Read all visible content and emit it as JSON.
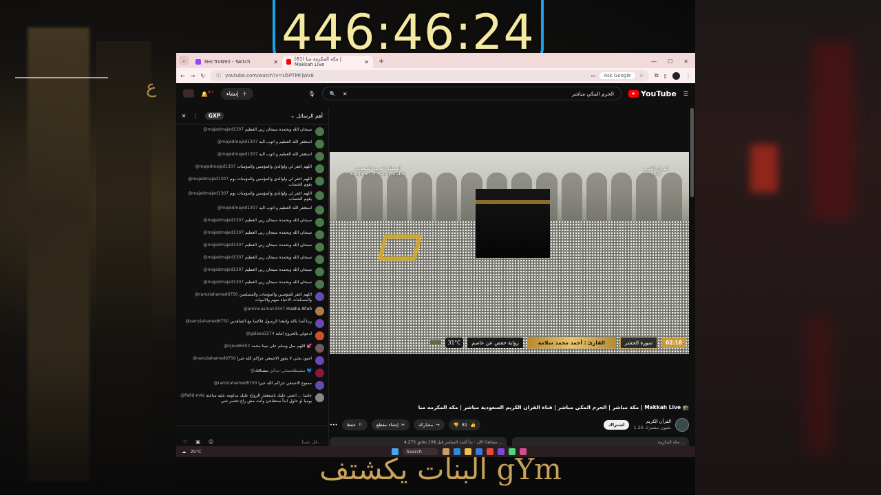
{
  "overlay": {
    "timer": "446:46:24",
    "caption": "البنات يكشتف gYm"
  },
  "browser": {
    "tabs": [
      {
        "label": "NecTroN90 - Twitch",
        "color": "#9146ff"
      },
      {
        "label": "(61) مكة المكرمة مبا | Makkah Live",
        "color": "#ff0000"
      }
    ],
    "url": "youtube.com/watch?v=U5PTMFjWx8",
    "ask_google": "Ask Google"
  },
  "youtube": {
    "logo": "YouTube",
    "search_query": "الحرم المكي مباشر",
    "create_label": "إنشاء",
    "notif_count": "9+"
  },
  "chat": {
    "title": "أهم الرسائل",
    "gxp": "GXP",
    "input_placeholder": "قل شيئا...",
    "messages": [
      {
        "author": "@majedmajed1307",
        "text": "سبحان الله وبحمده سبحان ربي العظيم",
        "av": "#4a7a4a"
      },
      {
        "author": "@majedmajed1307",
        "text": "استغفر الله العظيم و اتوب اليه",
        "av": "#4a7a4a"
      },
      {
        "author": "@majedmajed1307",
        "text": "استغفر الله العظيم و اتوب اليه",
        "av": "#4a7a4a"
      },
      {
        "author": "@majedmajed1307",
        "text": "اللهم اغفر لي ولوالدي والمؤمنين والمؤمنات",
        "av": "#4a7a4a"
      },
      {
        "author": "@majedmajed1307",
        "text": "اللهم اغفر لي ولوالدي والمؤمنين والمؤمنات يوم يقوم الحساب",
        "av": "#4a7a4a"
      },
      {
        "author": "@majedmajed1307",
        "text": "اللهم اغفر لي ولوالدي والمؤمنين والمؤمنات يوم يقوم الحساب",
        "av": "#4a7a4a"
      },
      {
        "author": "@majedmajed1307",
        "text": "استغفر الله العظيم و اتوب اليه",
        "av": "#4a7a4a"
      },
      {
        "author": "@majedmajed1307",
        "text": "سبحان الله وبحمده سبحان ربي العظيم",
        "av": "#4a7a4a"
      },
      {
        "author": "@majedmajed1307",
        "text": "سبحان الله وبحمده سبحان ربي العظيم",
        "av": "#4a7a4a"
      },
      {
        "author": "@majedmajed1307",
        "text": "سبحان الله وبحمده سبحان ربي العظيم",
        "av": "#4a7a4a"
      },
      {
        "author": "@majedmajed1307",
        "text": "سبحان الله وبحمده سبحان ربي العظيم",
        "av": "#4a7a4a"
      },
      {
        "author": "@majedmajed1307",
        "text": "سبحان الله وبحمده سبحان ربي العظيم",
        "av": "#4a7a4a"
      },
      {
        "author": "@majedmajed1307",
        "text": "سبحان الله وبحمده سبحان ربي العظيم",
        "av": "#4a7a4a"
      },
      {
        "author": "@ramziahamed6750",
        "text": "اللهم اغفر للمؤمنين والمؤمنات والمسلمين والمسلمات الاحياء منهم والاموات",
        "av": "#6a4ab0"
      },
      {
        "author": "@aminuusman3447",
        "text": "masha Allah",
        "av": "#b07a4a"
      },
      {
        "author": "@ramziahamed6750",
        "text": "ربنا آمنا بالله واتبعنا الرسول فاكتبنا مع الشاهدين",
        "av": "#6a4ab0"
      },
      {
        "author": "@galaxa3274",
        "text": "ادعولي بالخروج امانة",
        "av": "#d0502a"
      },
      {
        "author": "@njoud6452",
        "text": "اللهم صل وسلم على نبينا محمد 💕",
        "av": "#705a5a"
      },
      {
        "author": "@ramziahamed6750",
        "text": "اجيود بحتي لا يجوز الاجمعي جزاكم الله خيرا",
        "av": "#6a4ab0"
      },
      {
        "author": "@تنشيطلحسابي-ت3ي",
        "text": "مشتاقك 💙",
        "av": "#8a1a3a"
      },
      {
        "author": "@ramziahamed6750",
        "text": "ممنوع الاجمعي جزاكم الله خيرا",
        "av": "#6a4ab0"
      },
      {
        "author": "@Pelld-m4z",
        "text": "جانما ... اعتني عليك باستغفار الزواج عليك مداومه عليه ساعته يوميا او حاول ابدأ ستتفاجئ وأنت مش راح تخسر شي",
        "av": "#888888"
      }
    ]
  },
  "video": {
    "ksa_ar": "المملكة العربية السعودية",
    "ksa_en": "Kingdom of Saudi Arabia",
    "channel_badge": "القرآن الكريم",
    "channel_badge_sub": "Live",
    "time": "02:18",
    "surah": "سورة الحشر",
    "reader": "القارئ : أحمد محمد سلامة",
    "riwaya": "رواية حفص عن عاصم",
    "temp": "31°C"
  },
  "meta": {
    "title": "مكة مباشر | الحرم المكي مباشر | قناة القران الكريم السعودية مباشر | مكه المكرمه مبا | Makkah Live 🕋",
    "channel": "القرآن الكريم",
    "subs": "1.26 مليون مشترك",
    "subscribe": "اشتراك",
    "likes": "81",
    "share": "مشاركة",
    "clip": "إنشاء مقطع",
    "save": "حفظ",
    "desc_left": "4,275 مشاهدًا الآن · بدأ البث المباشر قبل 108 دقائق ...",
    "desc_right": "مكة المكرمة ..."
  },
  "taskbar": {
    "temp": "25°C",
    "search": "Search"
  }
}
